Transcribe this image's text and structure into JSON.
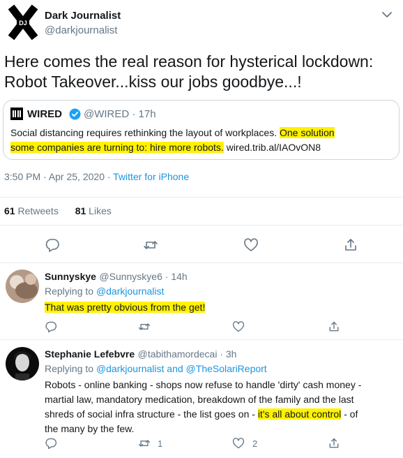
{
  "main_tweet": {
    "author_name": "Dark Journalist",
    "author_handle": "@darkjournalist",
    "avatar_text": "DJ",
    "text_line1": "Here comes the real reason for hysterical lockdown:",
    "text_line2": "Robot Takeover...kiss our jobs goodbye...!",
    "quote": {
      "name": "WIRED",
      "handle_time": "@WIRED · 17h",
      "text_plain": "Social distancing requires rethinking the layout of workplaces. ",
      "text_highlight_1": "One solution",
      "text_highlight_2": "some companies are turning to: hire more robots.",
      "link": " wired.trib.al/IAOvON8"
    },
    "timestamp": "3:50 PM · Apr 25, 2020 · ",
    "source": "Twitter for iPhone",
    "retweet_count": "61",
    "retweet_label": " Retweets",
    "like_count": "81",
    "like_label": " Likes"
  },
  "replies": [
    {
      "name": "Sunnyskye",
      "handle_time": "@Sunnyskye6 · 14h",
      "replying_prefix": "Replying to ",
      "replying_to": "@darkjournalist",
      "text": "That was pretty obvious from the get!"
    },
    {
      "name": "Stephanie Lefebvre",
      "handle_time": "@tabithamordecai · 3h",
      "replying_prefix": "Replying to ",
      "replying_to": "@darkjournalist and @TheSolariReport",
      "text_line1": "Robots - online banking - shops now refuse to handle 'dirty' cash money -",
      "text_line2": "martial law, mandatory medication, breakdown of the family and the last",
      "text_line3_pre": "shreds of social infra structure - the list goes on - ",
      "text_line3_hl": "it's all about control",
      "text_line3_post": " - of",
      "text_line4": "the many by the few.",
      "retweet_count": "1",
      "like_count": "2"
    }
  ],
  "colors": {
    "accent": "#1b95e0",
    "secondary": "#657786",
    "highlight": "#fff200",
    "divider": "#e6ecf0"
  },
  "icons": [
    "dj-logo-icon",
    "chevron-down-icon",
    "wired-logo-icon",
    "verified-badge-icon",
    "reply-icon",
    "retweet-icon",
    "like-icon",
    "share-icon"
  ]
}
